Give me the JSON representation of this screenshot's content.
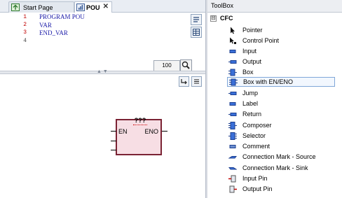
{
  "tabs": [
    {
      "label": "Start Page"
    },
    {
      "label": "POU"
    }
  ],
  "declaration": {
    "line_numbers": [
      "1",
      "2",
      "3",
      "4"
    ],
    "lines": [
      "PROGRAM POU",
      "VAR",
      "END_VAR",
      ""
    ]
  },
  "zoom": "100",
  "function_block": {
    "name": "???",
    "input": "EN",
    "output": "ENO"
  },
  "toolbox": {
    "title": "ToolBox",
    "group": "CFC",
    "group_toggle": "⊟",
    "items": [
      {
        "label": "Pointer",
        "icon": "pointer-icon"
      },
      {
        "label": "Control Point",
        "icon": "control-point-icon"
      },
      {
        "label": "Input",
        "icon": "input-icon"
      },
      {
        "label": "Output",
        "icon": "output-icon"
      },
      {
        "label": "Box",
        "icon": "box-icon"
      },
      {
        "label": "Box with EN/ENO",
        "icon": "box-en-eno-icon"
      },
      {
        "label": "Jump",
        "icon": "jump-icon"
      },
      {
        "label": "Label",
        "icon": "label-icon"
      },
      {
        "label": "Return",
        "icon": "return-icon"
      },
      {
        "label": "Composer",
        "icon": "composer-icon"
      },
      {
        "label": "Selector",
        "icon": "selector-icon"
      },
      {
        "label": "Comment",
        "icon": "comment-icon"
      },
      {
        "label": "Connection Mark - Source",
        "icon": "connection-source-icon"
      },
      {
        "label": "Connection Mark - Sink",
        "icon": "connection-sink-icon"
      },
      {
        "label": "Input Pin",
        "icon": "input-pin-icon"
      },
      {
        "label": "Output Pin",
        "icon": "output-pin-icon"
      }
    ],
    "selected_item": "Box with EN/ENO"
  },
  "colors": {
    "keyword": "#1b1ba8",
    "block_fill": "#f7dee4",
    "block_border": "#7b2334",
    "selection_border": "#7fa6d8"
  }
}
